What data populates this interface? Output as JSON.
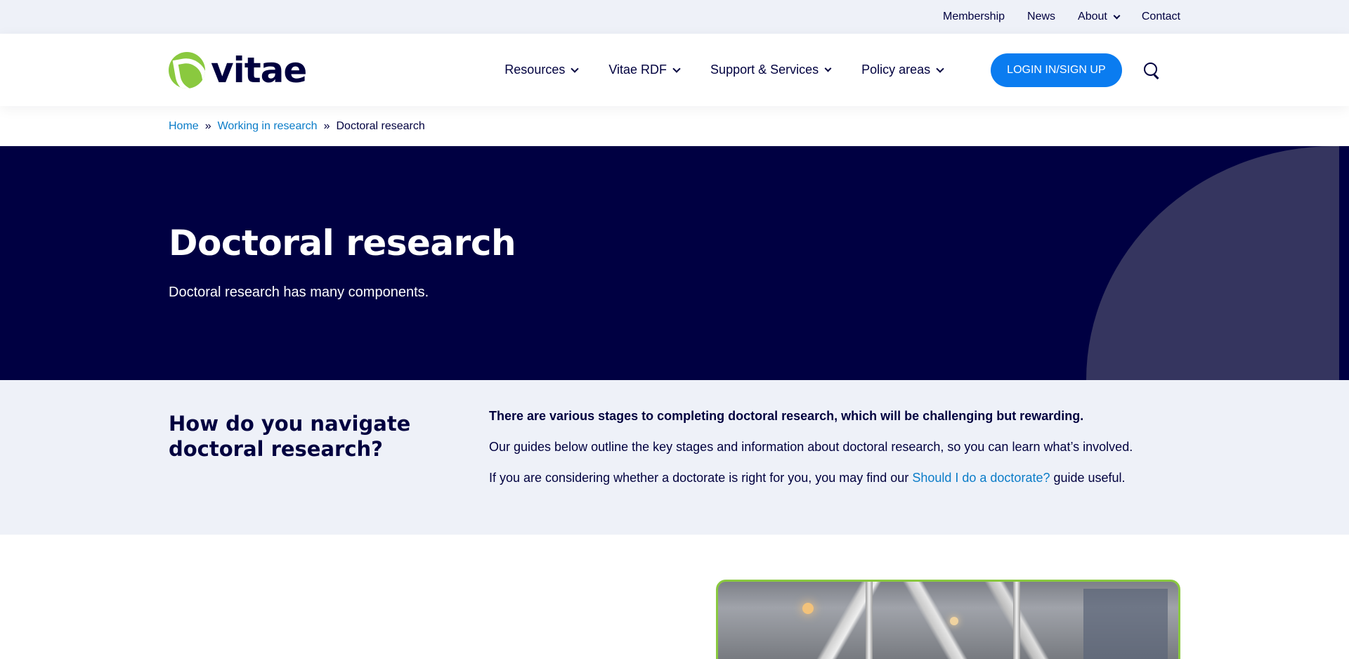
{
  "topbar": {
    "links": [
      "Membership",
      "News",
      "About",
      "Contact"
    ]
  },
  "header": {
    "logo_text": "vitae",
    "nav": [
      "Resources",
      "Vitae RDF",
      "Support & Services",
      "Policy areas"
    ],
    "login_label": "LOGIN IN/SIGN UP"
  },
  "breadcrumb": {
    "home": "Home",
    "parent": "Working in research",
    "current": "Doctoral research",
    "separator": "»"
  },
  "hero": {
    "title": "Doctoral research",
    "subtitle": "Doctoral research has many components."
  },
  "intro": {
    "heading": "How do you navigate doctoral research?",
    "lead": "There are various stages to completing doctoral research, which will be challenging but rewarding.",
    "body": "Our guides below outline the key stages and information about doctoral research, so you can learn what’s involved.",
    "consider_before": "If you are considering whether a doctorate is right for you, you may find our ",
    "consider_link": "Should I do a doctorate?",
    "consider_after": " guide useful."
  },
  "colors": {
    "navy": "#000042",
    "accent_blue": "#0a7cf0",
    "link_blue": "#0a7cc8",
    "logo_green": "#8ac93f",
    "pale_bg": "#eef1f8",
    "hero_shape": "#35355f"
  },
  "icons": {
    "search": "search-icon",
    "chevron": "chevron-down-icon",
    "logo": "vitae-logo-icon"
  }
}
